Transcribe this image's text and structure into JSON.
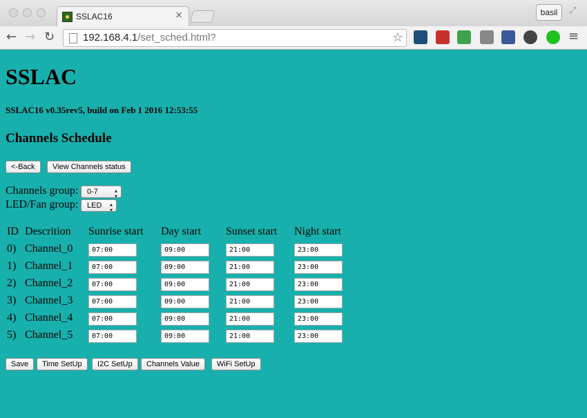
{
  "browser": {
    "tab_title": "SSLAC16",
    "tab_close": "×",
    "profile_name": "basil",
    "url_host": "192.168.4.1",
    "url_path": "/set_sched.html?",
    "nav": {
      "back": "←",
      "forward": "→",
      "reload": "↻"
    },
    "star": "☆",
    "menu": "≡",
    "fullscreen": "⤢",
    "extensions": [
      {
        "name": "analytics-extension-icon",
        "color": "#1f4e7a"
      },
      {
        "name": "javaee-extension-icon",
        "color": "#c8312b"
      },
      {
        "name": "badge-3-extension-icon",
        "color": "#3fa34d"
      },
      {
        "name": "face-extension-icon",
        "color": "#888888"
      },
      {
        "name": "facebook-extension-icon",
        "color": "#3b5998"
      },
      {
        "name": "steering-wheel-extension-icon",
        "color": "#444444"
      },
      {
        "name": "green-light-extension-icon",
        "color": "#1ec31e"
      }
    ]
  },
  "page": {
    "title": "SSLAC",
    "build_info": "SSLAC16 v0.35rev5, build on Feb 1 2016 12:53:55",
    "section_title": "Channels Schedule",
    "back_button": "<-Back",
    "view_status_button": "View Channels status",
    "channels_group_label": "Channels group:",
    "channels_group_value": "0-7",
    "led_group_label": "LED/Fan group:",
    "led_group_value": "LED",
    "table": {
      "headers": [
        "ID",
        "Descrition",
        "Sunrise start",
        "Day start",
        "Sunset start",
        "Night start"
      ],
      "rows": [
        {
          "id": "0)",
          "name": "Channel_0",
          "sunrise": "07:00",
          "day": "09:00",
          "sunset": "21:00",
          "night": "23:00"
        },
        {
          "id": "1)",
          "name": "Channel_1",
          "sunrise": "07:00",
          "day": "09:00",
          "sunset": "21:00",
          "night": "23:00"
        },
        {
          "id": "2)",
          "name": "Channel_2",
          "sunrise": "07:00",
          "day": "09:00",
          "sunset": "21:00",
          "night": "23:00"
        },
        {
          "id": "3)",
          "name": "Channel_3",
          "sunrise": "07:00",
          "day": "09:00",
          "sunset": "21:00",
          "night": "23:00"
        },
        {
          "id": "4)",
          "name": "Channel_4",
          "sunrise": "07:00",
          "day": "09:00",
          "sunset": "21:00",
          "night": "23:00"
        },
        {
          "id": "5)",
          "name": "Channel_5",
          "sunrise": "07:00",
          "day": "09:00",
          "sunset": "21:00",
          "night": "23:00"
        }
      ]
    },
    "bottom_buttons": [
      "Save",
      "Time SetUp",
      "I2C SetUp",
      "Channels Value",
      "WiFi SetUp"
    ],
    "background_color": "#18b0ad"
  }
}
